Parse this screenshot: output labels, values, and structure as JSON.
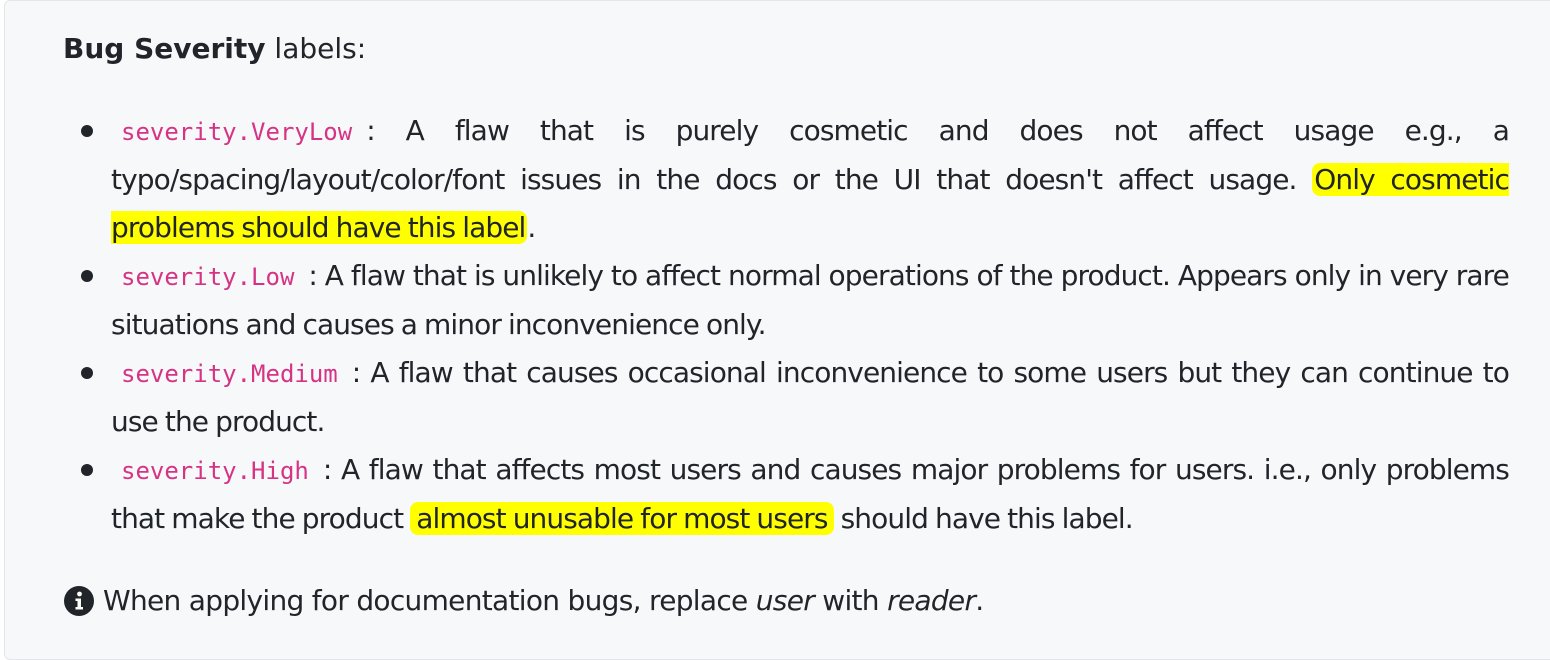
{
  "heading": {
    "bold": "Bug Severity",
    "rest": " labels:"
  },
  "items": [
    {
      "code": "severity.VeryLow",
      "text_before": ": A flaw that is purely cosmetic and does not affect usage e.g., a typo/spacing/layout/color/font issues in the docs or the UI that doesn't affect usage. ",
      "highlight": "Only cosmetic problems should have this label",
      "text_after": "."
    },
    {
      "code": "severity.Low",
      "text_before": ": A flaw that is unlikely to affect normal operations of the product. Appears only in very rare situations and causes a minor inconvenience only.",
      "highlight": "",
      "text_after": ""
    },
    {
      "code": "severity.Medium",
      "text_before": ": A flaw that causes occasional inconvenience to some users but they can continue to use the product.",
      "highlight": "",
      "text_after": ""
    },
    {
      "code": "severity.High",
      "text_before": ": A flaw that affects most users and causes major problems for users. i.e., only problems that make the product ",
      "highlight": "almost unusable for most users",
      "text_after": " should have this label."
    }
  ],
  "note": {
    "icon": "info-circle-icon",
    "text_before": "When applying for documentation bugs, replace ",
    "em1": "user",
    "text_middle": " with ",
    "em2": "reader",
    "text_after": "."
  },
  "colors": {
    "code": "#d63384",
    "highlight": "#ffff00",
    "panel_bg": "#f6f8fa",
    "text": "#212529"
  }
}
